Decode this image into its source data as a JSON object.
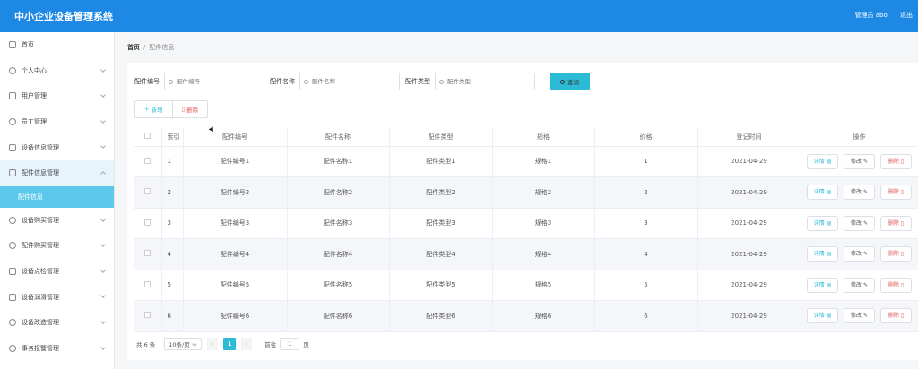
{
  "header": {
    "title": "中小企业设备管理系统",
    "user": "管理员 abo",
    "logout": "退出"
  },
  "sidebar": {
    "items": [
      {
        "label": "首页",
        "icon": "home-icon"
      },
      {
        "label": "个人中心",
        "icon": "user-icon"
      },
      {
        "label": "用户管理",
        "icon": "send-icon"
      },
      {
        "label": "员工管理",
        "icon": "gear-icon"
      },
      {
        "label": "设备信息管理",
        "icon": "pin-icon"
      },
      {
        "label": "配件信息管理",
        "icon": "crop-icon",
        "open": true,
        "sub": [
          "配件信息"
        ]
      },
      {
        "label": "设备购买管理",
        "icon": "clock-icon"
      },
      {
        "label": "配件购买管理",
        "icon": "gear-icon"
      },
      {
        "label": "设备点检管理",
        "icon": "briefcase-icon"
      },
      {
        "label": "设备润滑管理",
        "icon": "chart-icon"
      },
      {
        "label": "设备改造管理",
        "icon": "circle-icon"
      },
      {
        "label": "事务报警管理",
        "icon": "user-icon"
      }
    ]
  },
  "breadcrumb": {
    "home": "首页",
    "sep": "/",
    "current": "配件信息"
  },
  "search": {
    "fields": [
      {
        "label": "配件编号",
        "placeholder": "配件编号"
      },
      {
        "label": "配件名称",
        "placeholder": "配件名称"
      },
      {
        "label": "配件类型",
        "placeholder": "配件类型"
      }
    ],
    "query_label": "查询"
  },
  "actions": {
    "add_label": "新增",
    "delete_label": "删除"
  },
  "table": {
    "columns": [
      "索引",
      "配件编号",
      "配件名称",
      "配件类型",
      "规格",
      "价格",
      "登记时间",
      "操作"
    ],
    "rows": [
      {
        "index": "1",
        "code": "配件编号1",
        "name": "配件名称1",
        "type": "配件类型1",
        "spec": "规格1",
        "price": "1",
        "date": "2021-04-29"
      },
      {
        "index": "2",
        "code": "配件编号2",
        "name": "配件名称2",
        "type": "配件类型2",
        "spec": "规格2",
        "price": "2",
        "date": "2021-04-29"
      },
      {
        "index": "3",
        "code": "配件编号3",
        "name": "配件名称3",
        "type": "配件类型3",
        "spec": "规格3",
        "price": "3",
        "date": "2021-04-29"
      },
      {
        "index": "4",
        "code": "配件编号4",
        "name": "配件名称4",
        "type": "配件类型4",
        "spec": "规格4",
        "price": "4",
        "date": "2021-04-29"
      },
      {
        "index": "5",
        "code": "配件编号5",
        "name": "配件名称5",
        "type": "配件类型5",
        "spec": "规格5",
        "price": "5",
        "date": "2021-04-29"
      },
      {
        "index": "6",
        "code": "配件编号6",
        "name": "配件名称6",
        "type": "配件类型6",
        "spec": "规格6",
        "price": "6",
        "date": "2021-04-29"
      }
    ],
    "op_detail": "详情",
    "op_edit": "修改",
    "op_delete": "删除"
  },
  "pagination": {
    "total": "共 6 条",
    "page_size": "10条/页",
    "current_page": "1",
    "goto_label": "前往",
    "goto_value": "1",
    "page_suffix": "页"
  },
  "colors": {
    "header": "#1e88e5",
    "accent": "#2bbbd6",
    "active_sub": "#5bc8eb",
    "danger": "#e05a5a"
  }
}
